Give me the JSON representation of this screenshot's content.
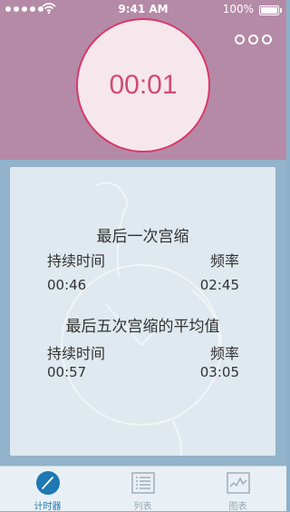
{
  "status_bar": {
    "time": "9:41 AM",
    "battery": "100%"
  },
  "timer": {
    "display": "00:01"
  },
  "card": {
    "last_section": {
      "title": "最后一次宫缩",
      "duration_label": "持续时间",
      "frequency_label": "频率",
      "duration_value": "00:46",
      "frequency_value": "02:45"
    },
    "avg_section": {
      "title": "最后五次宫缩的平均值",
      "duration_label": "持续时间",
      "frequency_label": "频率",
      "duration_value": "00:57",
      "frequency_value": "03:05"
    }
  },
  "tabs": [
    {
      "label": "计时器",
      "icon": "compass-icon",
      "active": true
    },
    {
      "label": "列表",
      "icon": "list-icon",
      "active": false
    },
    {
      "label": "图表",
      "icon": "chart-icon",
      "active": false
    }
  ],
  "colors": {
    "top_bg": "#b58aa7",
    "timer_ring": "#d8386b",
    "timer_text": "#d04b76",
    "middle_bg": "#92b3cb",
    "card_bg": "#dfe9ef",
    "tab_active": "#1d78b3",
    "tab_inactive": "#9aa8b3"
  }
}
